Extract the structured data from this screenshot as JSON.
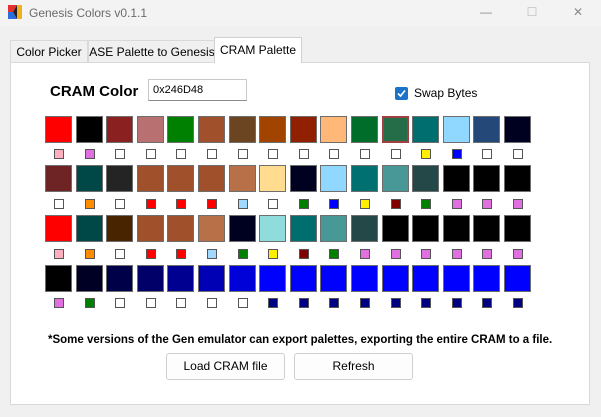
{
  "window": {
    "title": "Genesis Colors v0.1.1",
    "minimize_glyph": "—",
    "maximize_glyph": "☐",
    "close_glyph": "✕"
  },
  "tabs": [
    {
      "label": "Color Picker"
    },
    {
      "label": "ASE Palette to Genesis"
    },
    {
      "label": "CRAM Palette"
    }
  ],
  "cram": {
    "label": "CRAM Color",
    "value": "0x246D48",
    "swap_bytes_label": "Swap Bytes",
    "swap_bytes_checked": true
  },
  "palette_rows": [
    [
      "#ff0000",
      "#000000",
      "#8b2020",
      "#b87070",
      "#008000",
      "#a0502a",
      "#6b4422",
      "#a04400",
      "#902000",
      "#ffb878",
      "#006e2a",
      "#246d48",
      "#006e6e",
      "#90d8ff",
      "#244878",
      "#000020"
    ],
    [
      "#6e2424",
      "#004848",
      "#242424",
      "#a0502a",
      "#a0502a",
      "#a0502a",
      "#b87048",
      "#ffdc90",
      "#000020",
      "#90d8ff",
      "#007070",
      "#489898",
      "#244848",
      "#000000",
      "#000000",
      "#000000"
    ],
    [
      "#ff0000",
      "#004848",
      "#482400",
      "#a0502a",
      "#a0502a",
      "#b87048",
      "#000020",
      "#90dcdc",
      "#006e6e",
      "#489898",
      "#244848",
      "#000000",
      "#000000",
      "#000000",
      "#000000",
      "#000000"
    ],
    [
      "#000000",
      "#000024",
      "#000048",
      "#000068",
      "#000090",
      "#0000b4",
      "#0000d8",
      "#0000ff",
      "#0000ff",
      "#0000ff",
      "#0000ff",
      "#0000ff",
      "#0000ff",
      "#0000ff",
      "#0000ff",
      "#0000ff"
    ]
  ],
  "selected_swatch": "row0-col11",
  "indicator_rows": [
    [
      "#ffb0c0",
      "#e070e0",
      "#ffffff",
      "#ffffff",
      "#ffffff",
      "#ffffff",
      "#ffffff",
      "#ffffff",
      "#ffffff",
      "#ffffff",
      "#ffffff",
      "#ffffff",
      "#ffee00",
      "#0000ff",
      "#ffffff",
      "#ffffff"
    ],
    [
      "#ffffff",
      "#ff8c00",
      "#ffffff",
      "#ff0000",
      "#ff0000",
      "#ff0000",
      "#a0d8ff",
      "#ffffff",
      "#008000",
      "#0000ff",
      "#ffee00",
      "#800000",
      "#008000",
      "#e070e0",
      "#e070e0",
      "#e070e0"
    ],
    [
      "#ffb0c0",
      "#ff8c00",
      "#ffffff",
      "#ff0000",
      "#ff0000",
      "#a0d8ff",
      "#008000",
      "#ffee00",
      "#800000",
      "#008000",
      "#e070e0",
      "#e070e0",
      "#e070e0",
      "#e070e0",
      "#e070e0",
      "#e070e0"
    ],
    [
      "#e070e0",
      "#008000",
      "#ffffff",
      "#ffffff",
      "#ffffff",
      "#ffffff",
      "#ffffff",
      "#000080",
      "#000080",
      "#000080",
      "#000080",
      "#000080",
      "#000080",
      "#000080",
      "#000080",
      "#000080"
    ]
  ],
  "note": "*Some versions of the Gen emulator can export palettes, exporting the entire CRAM to a file.",
  "buttons": {
    "load": "Load CRAM file",
    "refresh": "Refresh"
  },
  "colors": {
    "accent": "#1a73c9",
    "selected_border": "#a04040"
  },
  "icons": {
    "app": "genesis-logo-icon",
    "check": "checkmark-icon"
  }
}
